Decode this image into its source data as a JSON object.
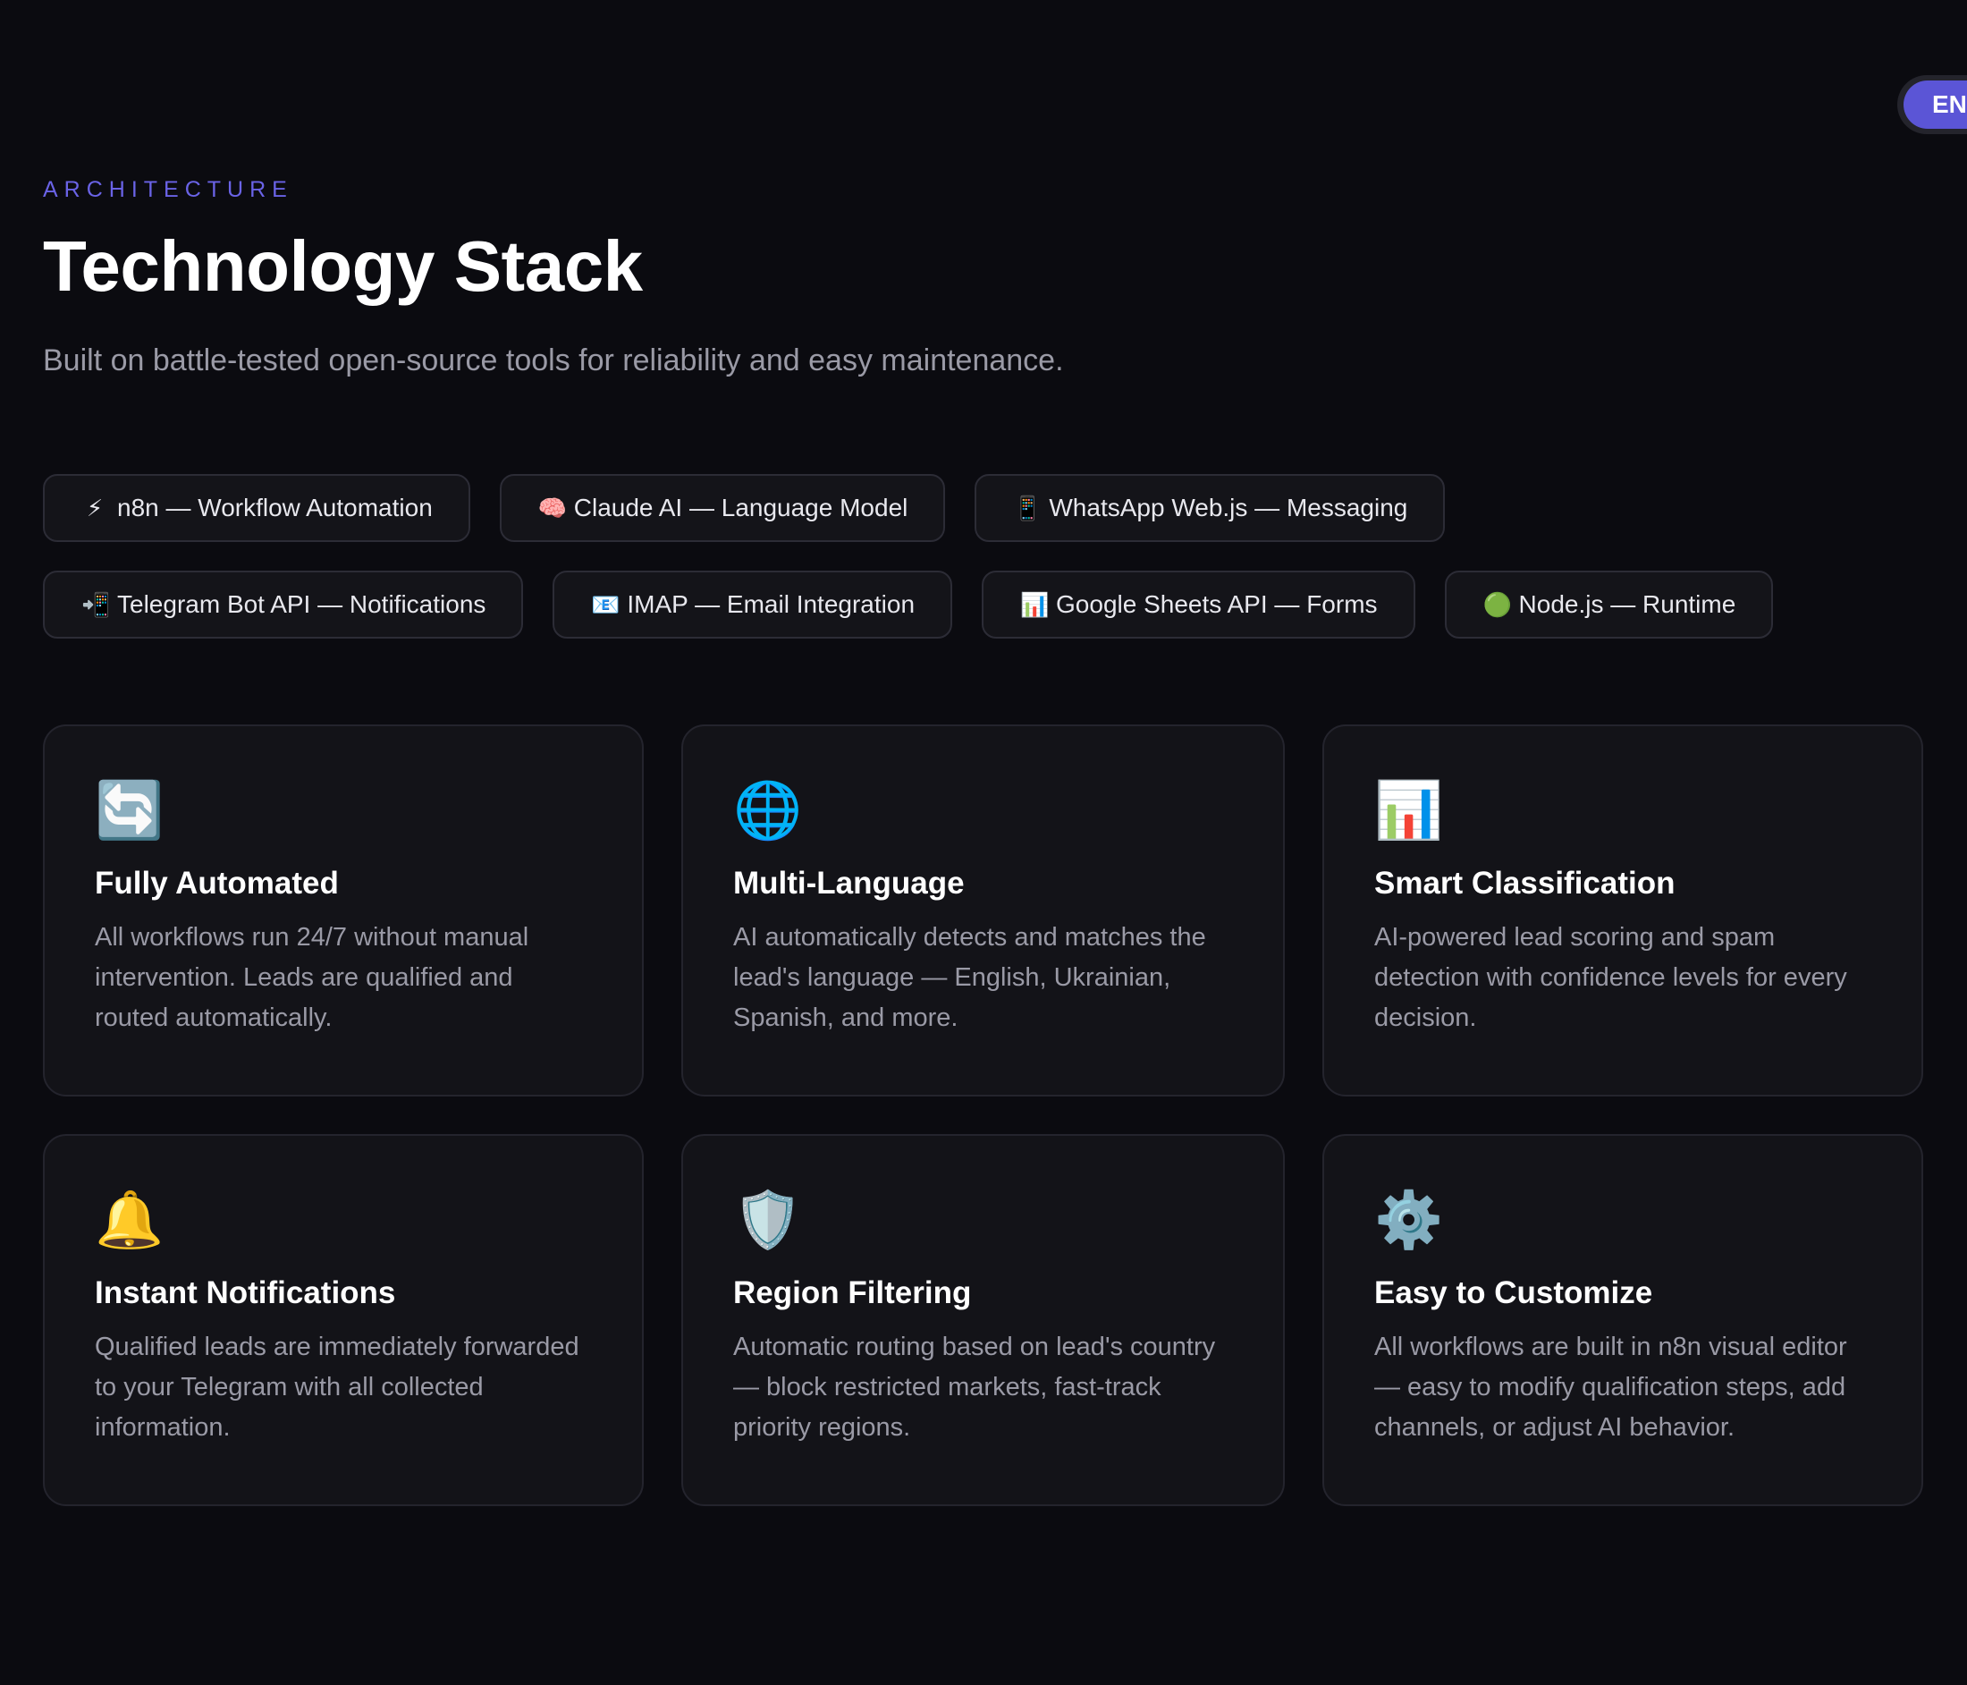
{
  "lang_toggle": {
    "label": "EN"
  },
  "section": {
    "eyebrow": "ARCHITECTURE",
    "title": "Technology Stack",
    "subtitle": "Built on battle-tested open-source tools for reliability and easy maintenance."
  },
  "tech_tags": [
    {
      "icon": "lightning-icon",
      "emoji": "⚡",
      "label": "n8n — Workflow Automation"
    },
    {
      "icon": "brain-icon",
      "emoji": "🧠",
      "label": "Claude AI — Language Model"
    },
    {
      "icon": "phone-icon",
      "emoji": "📱",
      "label": "WhatsApp Web.js — Messaging"
    },
    {
      "icon": "phone-arrow-icon",
      "emoji": "📲",
      "label": "Telegram Bot API — Notifications"
    },
    {
      "icon": "email-icon",
      "emoji": "📧",
      "label": "IMAP — Email Integration"
    },
    {
      "icon": "bar-chart-icon",
      "emoji": "📊",
      "label": "Google Sheets API — Forms"
    },
    {
      "icon": "green-circle-icon",
      "emoji": "🟢",
      "label": "Node.js — Runtime"
    }
  ],
  "features": [
    {
      "icon": "repeat-arrows-icon",
      "emoji": "🔄",
      "title": "Fully Automated",
      "description": "All workflows run 24/7 without manual intervention. Leads are qualified and routed automatically."
    },
    {
      "icon": "globe-icon",
      "emoji": "🌐",
      "title": "Multi-Language",
      "description": "AI automatically detects and matches the lead's language — English, Ukrainian, Spanish, and more."
    },
    {
      "icon": "bar-chart-icon",
      "emoji": "📊",
      "title": "Smart Classification",
      "description": "AI-powered lead scoring and spam detection with confidence levels for every decision."
    },
    {
      "icon": "bell-icon",
      "emoji": "🔔",
      "title": "Instant Notifications",
      "description": "Qualified leads are immediately forwarded to your Telegram with all collected information."
    },
    {
      "icon": "shield-icon",
      "emoji": "🛡️",
      "title": "Region Filtering",
      "description": "Automatic routing based on lead's country — block restricted markets, fast-track priority regions."
    },
    {
      "icon": "gear-icon",
      "emoji": "⚙️",
      "title": "Easy to Customize",
      "description": "All workflows are built in n8n visual editor — easy to modify qualification steps, add channels, or adjust AI behavior."
    }
  ],
  "colors": {
    "background": "#0b0b10",
    "accent": "#6a63e6",
    "toggle": "#5b55d6",
    "card": "#131318",
    "muted_text": "#9a9aa6"
  }
}
